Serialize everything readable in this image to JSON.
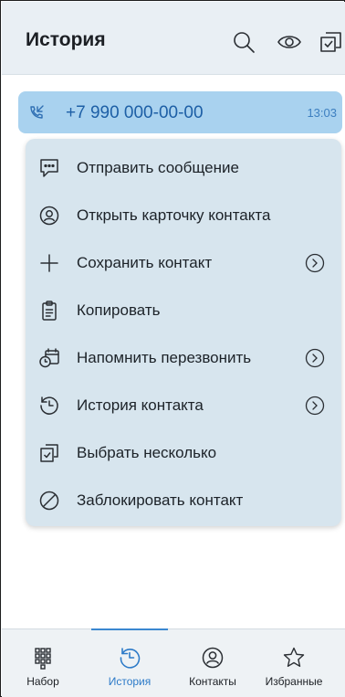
{
  "header": {
    "title": "История",
    "icons": [
      "search-icon",
      "eye-icon",
      "select-multiple-icon"
    ]
  },
  "call": {
    "number": "+7 990 000-00-00",
    "time": "13:03",
    "icon": "incoming-call-icon"
  },
  "menu": {
    "items": [
      {
        "label": "Отправить сообщение",
        "icon": "message-icon",
        "submenu": false
      },
      {
        "label": "Открыть карточку контакта",
        "icon": "contact-card-icon",
        "submenu": false
      },
      {
        "label": "Сохранить контакт",
        "icon": "plus-icon",
        "submenu": true
      },
      {
        "label": "Копировать",
        "icon": "clipboard-icon",
        "submenu": false
      },
      {
        "label": "Напомнить перезвонить",
        "icon": "reminder-icon",
        "submenu": true
      },
      {
        "label": "История контакта",
        "icon": "history-icon",
        "submenu": true
      },
      {
        "label": "Выбрать несколько",
        "icon": "select-multiple-icon",
        "submenu": false
      },
      {
        "label": "Заблокировать контакт",
        "icon": "block-icon",
        "submenu": false
      }
    ]
  },
  "nav": {
    "items": [
      {
        "label": "Набор",
        "icon": "dialpad-icon",
        "active": false
      },
      {
        "label": "История",
        "icon": "history-icon",
        "active": true
      },
      {
        "label": "Контакты",
        "icon": "contacts-icon",
        "active": false
      },
      {
        "label": "Избранные",
        "icon": "star-icon",
        "active": false
      }
    ]
  },
  "colors": {
    "accent": "#2c7ac8",
    "call_row_bg": "#a9d2ef",
    "menu_bg": "#d7e5ee"
  }
}
